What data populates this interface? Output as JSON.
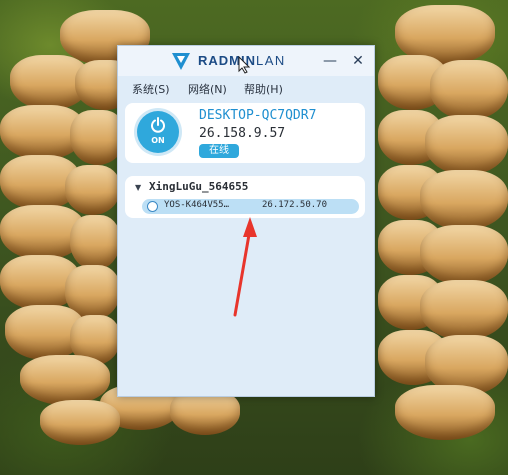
{
  "window": {
    "app_name_prefix": "RADMIN",
    "app_name_suffix": "LAN",
    "minimize_glyph": "—",
    "close_glyph": "✕"
  },
  "menu": [
    {
      "label": "系统(S)"
    },
    {
      "label": "网络(N)"
    },
    {
      "label": "帮助(H)"
    }
  ],
  "host": {
    "power_label": "ON",
    "name": "DESKTOP-QC7QDR7",
    "ip": "26.158.9.57",
    "status": "在线"
  },
  "network": {
    "name": "XingLuGu_564655",
    "peers": [
      {
        "name": "YOS-K464V55…",
        "ip": "26.172.50.70"
      }
    ]
  },
  "colors": {
    "accent": "#2fa8dc",
    "host_name": "#1f8fd0",
    "annotation_arrow": "#e8352c"
  },
  "icons": [
    "radmin-logo-icon",
    "power-icon",
    "minimize-icon",
    "close-icon",
    "caret-down-icon",
    "peer-status-icon",
    "cursor-icon"
  ]
}
